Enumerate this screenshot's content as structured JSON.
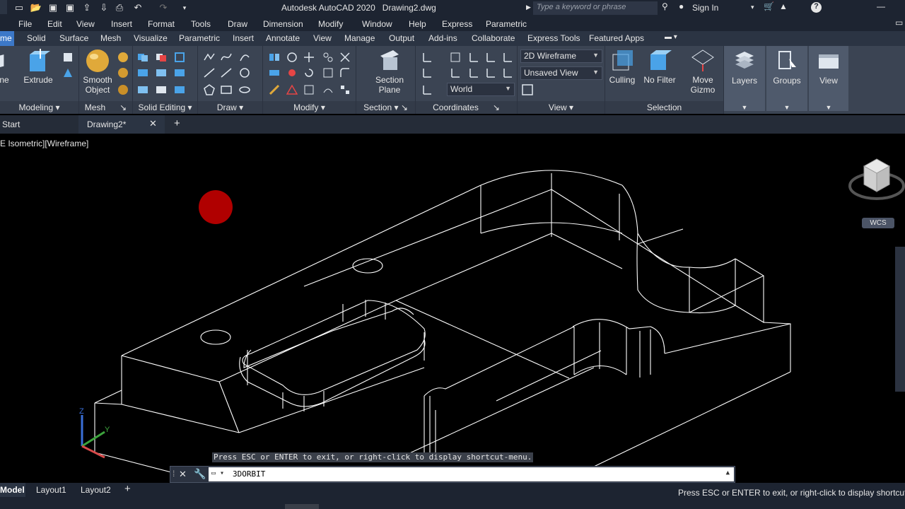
{
  "title": "Autodesk AutoCAD 2020",
  "filename": "Drawing2.dwg",
  "search_placeholder": "Type a keyword or phrase",
  "sign_in": "Sign In",
  "menu": [
    "File",
    "Edit",
    "View",
    "Insert",
    "Format",
    "Tools",
    "Draw",
    "Dimension",
    "Modify",
    "Window",
    "Help",
    "Express",
    "Parametric"
  ],
  "ribbon_tabs": [
    "me",
    "Solid",
    "Surface",
    "Mesh",
    "Visualize",
    "Parametric",
    "Insert",
    "Annotate",
    "View",
    "Manage",
    "Output",
    "Add-ins",
    "Collaborate",
    "Express Tools",
    "Featured Apps"
  ],
  "ribbon": {
    "modeling": {
      "label": "Modeling",
      "extrude": "Extrude",
      "box": "ne"
    },
    "mesh": {
      "label": "Mesh",
      "smooth_line1": "Smooth",
      "smooth_line2": "Object"
    },
    "solid_editing": {
      "label": "Solid Editing"
    },
    "draw": {
      "label": "Draw"
    },
    "modify": {
      "label": "Modify"
    },
    "section": {
      "label": "Section",
      "plane_line1": "Section",
      "plane_line2": "Plane"
    },
    "coordinates": {
      "label": "Coordinates",
      "ucs": "World"
    },
    "view": {
      "label": "View",
      "visual_style": "2D Wireframe",
      "named_view": "Unsaved View"
    },
    "selection": {
      "label": "Selection",
      "culling": "Culling",
      "nofilter": "No Filter",
      "gizmo_line1": "Move",
      "gizmo_line2": "Gizmo"
    },
    "layers": "Layers",
    "groups": "Groups",
    "viewpanel": "View"
  },
  "doc_tabs": {
    "start": "Start",
    "drawing": "Drawing2*"
  },
  "viewport_label": "E Isometric][Wireframe]",
  "wcs": "WCS",
  "command": {
    "hint": "Press ESC or ENTER to exit, or right-click to display shortcut-menu.",
    "value": "3DORBIT"
  },
  "layout_tabs": [
    "Model",
    "Layout1",
    "Layout2"
  ],
  "status_message": "Press ESC or ENTER to exit, or right-click to display shortcut-m"
}
